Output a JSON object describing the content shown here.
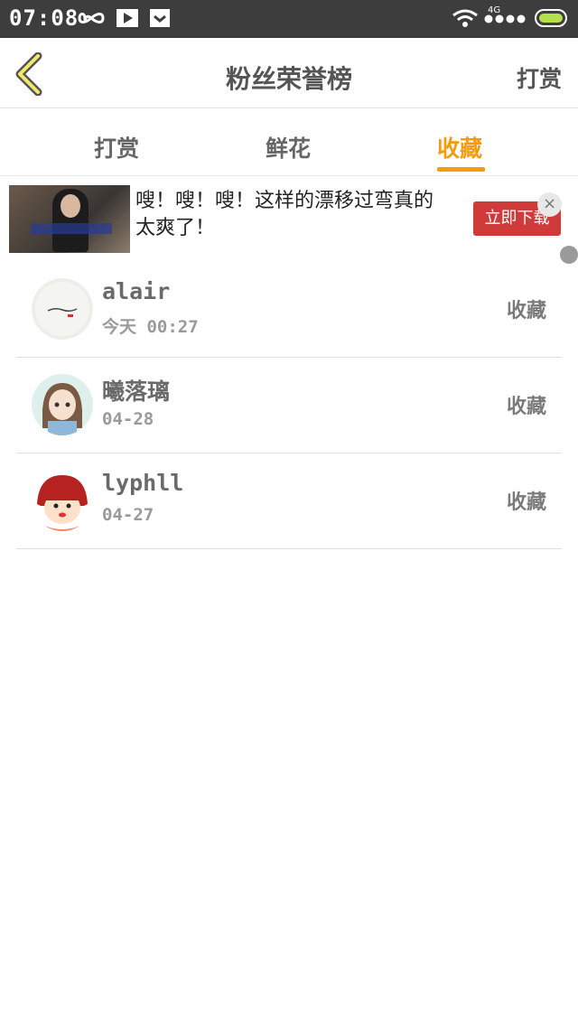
{
  "statusbar": {
    "time": "07:08",
    "network": "4G"
  },
  "header": {
    "title": "粉丝荣誉榜",
    "right_action": "打赏"
  },
  "tabs": [
    {
      "label": "打赏",
      "active": false
    },
    {
      "label": "鲜花",
      "active": false
    },
    {
      "label": "收藏",
      "active": true
    }
  ],
  "ad": {
    "text": "嗖！嗖！嗖！这样的漂移过弯真的太爽了！",
    "button": "立即下载",
    "close": "×"
  },
  "users": [
    {
      "name": "alair",
      "date": "今天 00:27",
      "action": "收藏"
    },
    {
      "name": "曦落璃",
      "date": "04-28",
      "action": "收藏"
    },
    {
      "name": "lyphll",
      "date": "04-27",
      "action": "收藏"
    }
  ],
  "colors": {
    "accent": "#f39c12",
    "statusbar": "#3d3d3d",
    "ad_button": "#cf3b3b"
  }
}
